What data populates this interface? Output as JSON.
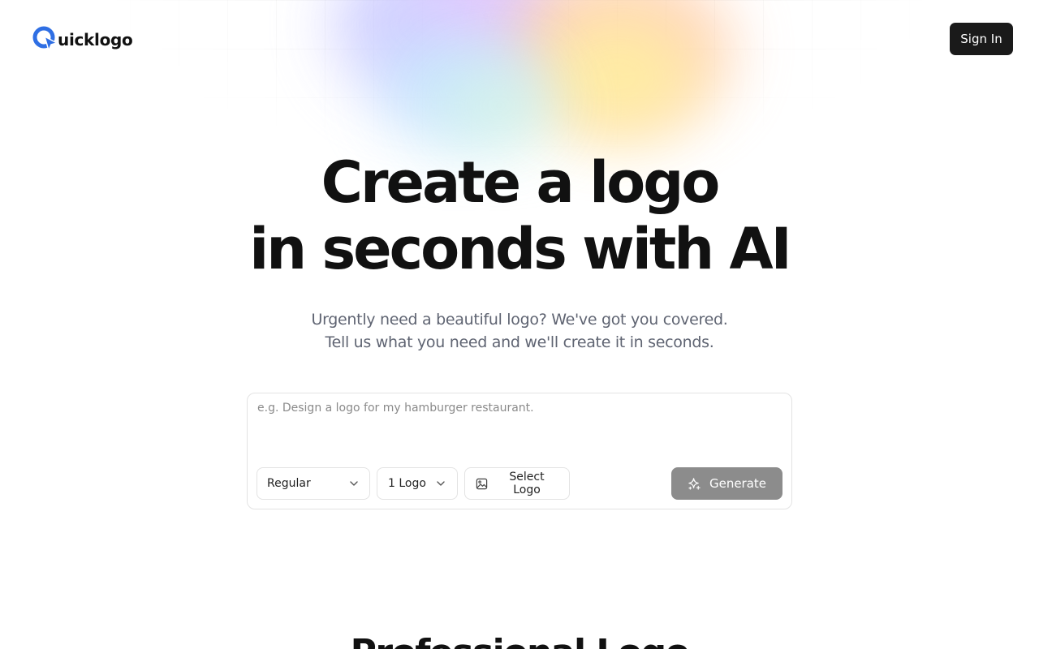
{
  "header": {
    "brand_initial": "Q",
    "brand_rest": "uicklogo",
    "sign_in_label": "Sign In"
  },
  "hero": {
    "title_line1": "Create a logo",
    "title_line2": "in seconds with AI",
    "subtitle_line1": "Urgently need a beautiful logo? We've got you covered.",
    "subtitle_line2": "Tell us what you need and we'll create it in seconds."
  },
  "prompt": {
    "placeholder": "e.g. Design a logo for my hamburger restaurant.",
    "value": "",
    "style_value": "Regular",
    "count_value": "1 Logo",
    "select_logo_label": "Select Logo",
    "generate_label": "Generate"
  },
  "section": {
    "heading": "Professional Logo"
  },
  "colors": {
    "brand_blue": "#2f6fe4",
    "dark_button": "#1a1a1a",
    "generate_disabled": "#8c8c8c"
  },
  "icons": {
    "brand": "quicklogo-cursor-icon",
    "chevron": "chevron-down-icon",
    "image": "image-icon",
    "sparkle": "sparkle-icon"
  }
}
